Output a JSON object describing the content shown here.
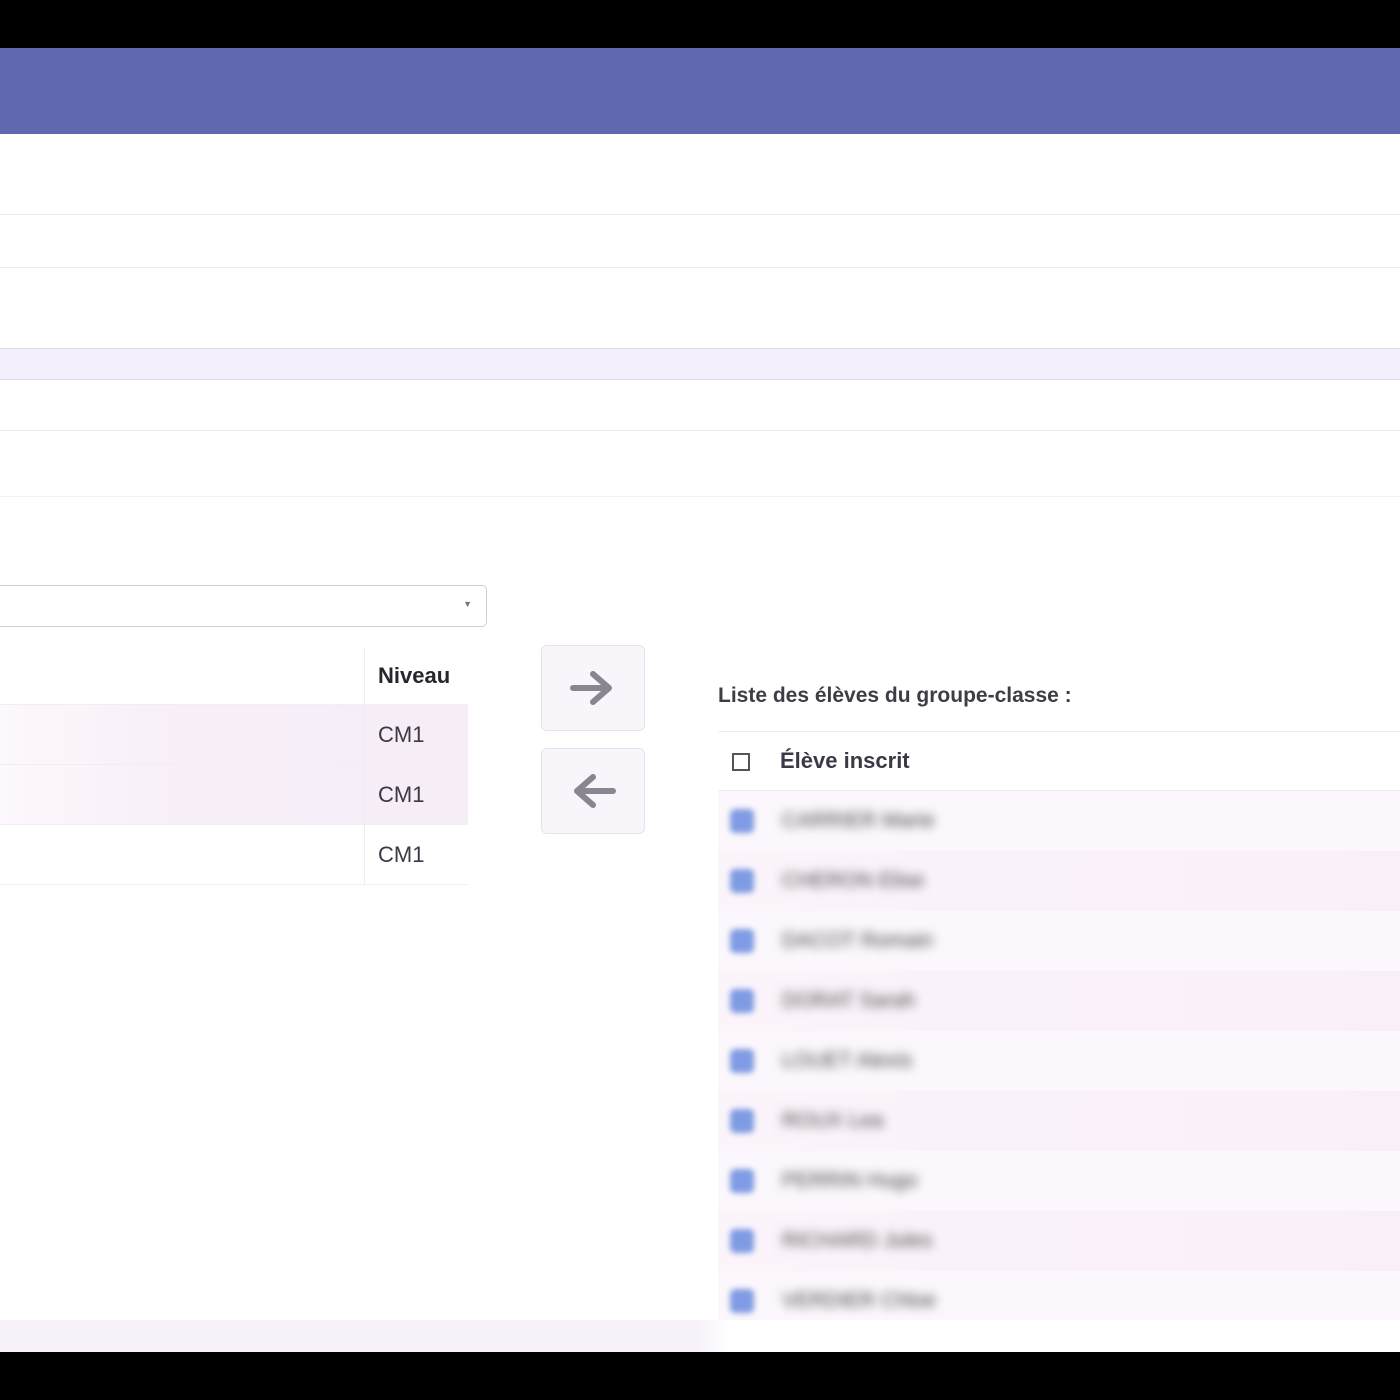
{
  "right_panel": {
    "title": "Liste des élèves du groupe-classe :",
    "header_label": "Élève inscrit",
    "students": [
      {
        "name": "CARRIER Marie"
      },
      {
        "name": "CHERON Elise"
      },
      {
        "name": "DACOT Romain"
      },
      {
        "name": "DORAT Sarah"
      },
      {
        "name": "LOUET Alexis"
      },
      {
        "name": "ROUX Lea"
      },
      {
        "name": "PERRIN Hugo"
      },
      {
        "name": "RICHARD Jules"
      },
      {
        "name": "VERDIER Chloe"
      }
    ]
  },
  "left_table": {
    "header": "Niveau",
    "rows": [
      {
        "niveau": "CM1"
      },
      {
        "niveau": "CM1"
      },
      {
        "niveau": "CM1"
      }
    ]
  },
  "icons": {
    "move_right": "arrow-right-icon",
    "move_left": "arrow-left-icon",
    "dropdown": "chevron-down-icon"
  },
  "colors": {
    "header": "#6168af",
    "student_checkbox": "#7f9be3",
    "row_highlight": "#f7eef8",
    "arrow": "#8a8590"
  }
}
